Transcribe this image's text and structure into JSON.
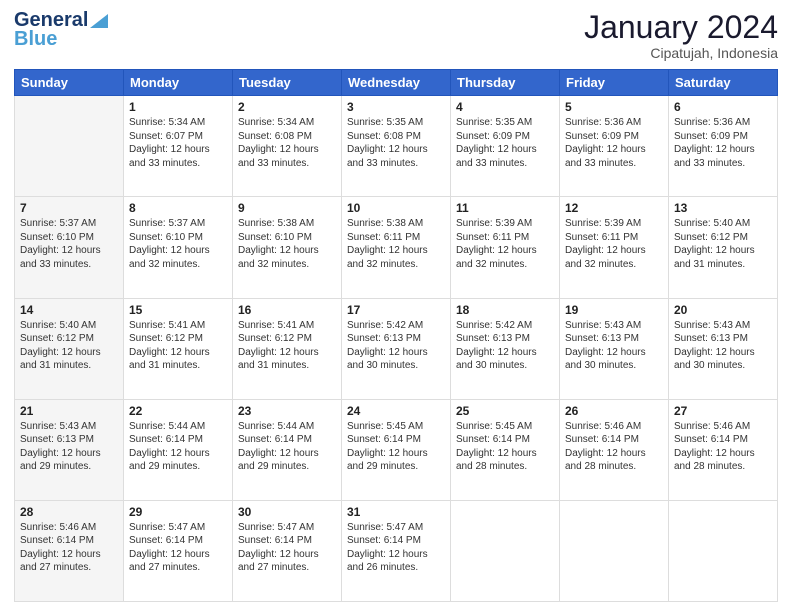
{
  "header": {
    "logo_line1": "General",
    "logo_line2": "Blue",
    "title": "January 2024",
    "location": "Cipatujah, Indonesia"
  },
  "weekdays": [
    "Sunday",
    "Monday",
    "Tuesday",
    "Wednesday",
    "Thursday",
    "Friday",
    "Saturday"
  ],
  "weeks": [
    [
      {
        "day": "",
        "sunrise": "",
        "sunset": "",
        "daylight": ""
      },
      {
        "day": "1",
        "sunrise": "Sunrise: 5:34 AM",
        "sunset": "Sunset: 6:07 PM",
        "daylight": "Daylight: 12 hours and 33 minutes."
      },
      {
        "day": "2",
        "sunrise": "Sunrise: 5:34 AM",
        "sunset": "Sunset: 6:08 PM",
        "daylight": "Daylight: 12 hours and 33 minutes."
      },
      {
        "day": "3",
        "sunrise": "Sunrise: 5:35 AM",
        "sunset": "Sunset: 6:08 PM",
        "daylight": "Daylight: 12 hours and 33 minutes."
      },
      {
        "day": "4",
        "sunrise": "Sunrise: 5:35 AM",
        "sunset": "Sunset: 6:09 PM",
        "daylight": "Daylight: 12 hours and 33 minutes."
      },
      {
        "day": "5",
        "sunrise": "Sunrise: 5:36 AM",
        "sunset": "Sunset: 6:09 PM",
        "daylight": "Daylight: 12 hours and 33 minutes."
      },
      {
        "day": "6",
        "sunrise": "Sunrise: 5:36 AM",
        "sunset": "Sunset: 6:09 PM",
        "daylight": "Daylight: 12 hours and 33 minutes."
      }
    ],
    [
      {
        "day": "7",
        "sunrise": "Sunrise: 5:37 AM",
        "sunset": "Sunset: 6:10 PM",
        "daylight": "Daylight: 12 hours and 33 minutes."
      },
      {
        "day": "8",
        "sunrise": "Sunrise: 5:37 AM",
        "sunset": "Sunset: 6:10 PM",
        "daylight": "Daylight: 12 hours and 32 minutes."
      },
      {
        "day": "9",
        "sunrise": "Sunrise: 5:38 AM",
        "sunset": "Sunset: 6:10 PM",
        "daylight": "Daylight: 12 hours and 32 minutes."
      },
      {
        "day": "10",
        "sunrise": "Sunrise: 5:38 AM",
        "sunset": "Sunset: 6:11 PM",
        "daylight": "Daylight: 12 hours and 32 minutes."
      },
      {
        "day": "11",
        "sunrise": "Sunrise: 5:39 AM",
        "sunset": "Sunset: 6:11 PM",
        "daylight": "Daylight: 12 hours and 32 minutes."
      },
      {
        "day": "12",
        "sunrise": "Sunrise: 5:39 AM",
        "sunset": "Sunset: 6:11 PM",
        "daylight": "Daylight: 12 hours and 32 minutes."
      },
      {
        "day": "13",
        "sunrise": "Sunrise: 5:40 AM",
        "sunset": "Sunset: 6:12 PM",
        "daylight": "Daylight: 12 hours and 31 minutes."
      }
    ],
    [
      {
        "day": "14",
        "sunrise": "Sunrise: 5:40 AM",
        "sunset": "Sunset: 6:12 PM",
        "daylight": "Daylight: 12 hours and 31 minutes."
      },
      {
        "day": "15",
        "sunrise": "Sunrise: 5:41 AM",
        "sunset": "Sunset: 6:12 PM",
        "daylight": "Daylight: 12 hours and 31 minutes."
      },
      {
        "day": "16",
        "sunrise": "Sunrise: 5:41 AM",
        "sunset": "Sunset: 6:12 PM",
        "daylight": "Daylight: 12 hours and 31 minutes."
      },
      {
        "day": "17",
        "sunrise": "Sunrise: 5:42 AM",
        "sunset": "Sunset: 6:13 PM",
        "daylight": "Daylight: 12 hours and 30 minutes."
      },
      {
        "day": "18",
        "sunrise": "Sunrise: 5:42 AM",
        "sunset": "Sunset: 6:13 PM",
        "daylight": "Daylight: 12 hours and 30 minutes."
      },
      {
        "day": "19",
        "sunrise": "Sunrise: 5:43 AM",
        "sunset": "Sunset: 6:13 PM",
        "daylight": "Daylight: 12 hours and 30 minutes."
      },
      {
        "day": "20",
        "sunrise": "Sunrise: 5:43 AM",
        "sunset": "Sunset: 6:13 PM",
        "daylight": "Daylight: 12 hours and 30 minutes."
      }
    ],
    [
      {
        "day": "21",
        "sunrise": "Sunrise: 5:43 AM",
        "sunset": "Sunset: 6:13 PM",
        "daylight": "Daylight: 12 hours and 29 minutes."
      },
      {
        "day": "22",
        "sunrise": "Sunrise: 5:44 AM",
        "sunset": "Sunset: 6:14 PM",
        "daylight": "Daylight: 12 hours and 29 minutes."
      },
      {
        "day": "23",
        "sunrise": "Sunrise: 5:44 AM",
        "sunset": "Sunset: 6:14 PM",
        "daylight": "Daylight: 12 hours and 29 minutes."
      },
      {
        "day": "24",
        "sunrise": "Sunrise: 5:45 AM",
        "sunset": "Sunset: 6:14 PM",
        "daylight": "Daylight: 12 hours and 29 minutes."
      },
      {
        "day": "25",
        "sunrise": "Sunrise: 5:45 AM",
        "sunset": "Sunset: 6:14 PM",
        "daylight": "Daylight: 12 hours and 28 minutes."
      },
      {
        "day": "26",
        "sunrise": "Sunrise: 5:46 AM",
        "sunset": "Sunset: 6:14 PM",
        "daylight": "Daylight: 12 hours and 28 minutes."
      },
      {
        "day": "27",
        "sunrise": "Sunrise: 5:46 AM",
        "sunset": "Sunset: 6:14 PM",
        "daylight": "Daylight: 12 hours and 28 minutes."
      }
    ],
    [
      {
        "day": "28",
        "sunrise": "Sunrise: 5:46 AM",
        "sunset": "Sunset: 6:14 PM",
        "daylight": "Daylight: 12 hours and 27 minutes."
      },
      {
        "day": "29",
        "sunrise": "Sunrise: 5:47 AM",
        "sunset": "Sunset: 6:14 PM",
        "daylight": "Daylight: 12 hours and 27 minutes."
      },
      {
        "day": "30",
        "sunrise": "Sunrise: 5:47 AM",
        "sunset": "Sunset: 6:14 PM",
        "daylight": "Daylight: 12 hours and 27 minutes."
      },
      {
        "day": "31",
        "sunrise": "Sunrise: 5:47 AM",
        "sunset": "Sunset: 6:14 PM",
        "daylight": "Daylight: 12 hours and 26 minutes."
      },
      {
        "day": "",
        "sunrise": "",
        "sunset": "",
        "daylight": ""
      },
      {
        "day": "",
        "sunrise": "",
        "sunset": "",
        "daylight": ""
      },
      {
        "day": "",
        "sunrise": "",
        "sunset": "",
        "daylight": ""
      }
    ]
  ]
}
